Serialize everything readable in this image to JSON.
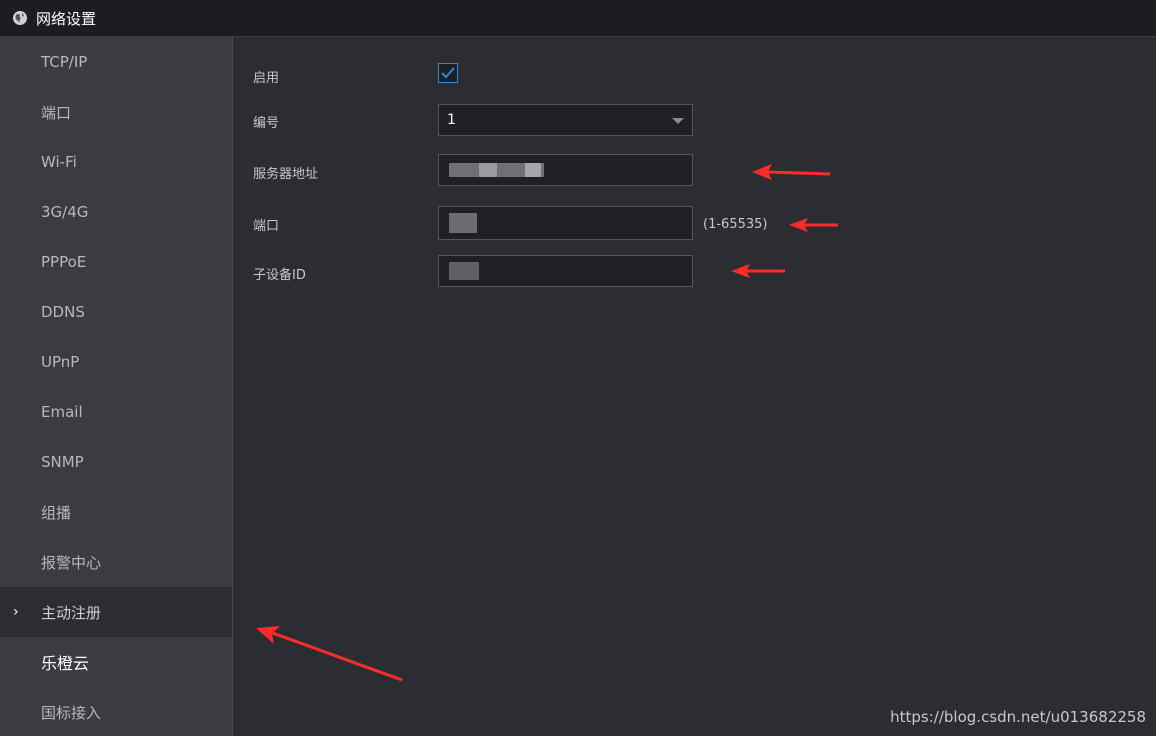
{
  "window": {
    "title": "网络设置",
    "icon": "globe-icon"
  },
  "sidebar": {
    "items": [
      {
        "label": "TCP/IP"
      },
      {
        "label": "端口"
      },
      {
        "label": "Wi-Fi"
      },
      {
        "label": "3G/4G"
      },
      {
        "label": "PPPoE"
      },
      {
        "label": "DDNS"
      },
      {
        "label": "UPnP"
      },
      {
        "label": "Email"
      },
      {
        "label": "SNMP"
      },
      {
        "label": "组播"
      },
      {
        "label": "报警中心"
      },
      {
        "label": "主动注册",
        "active": true,
        "marker": "›"
      },
      {
        "label": "乐橙云"
      },
      {
        "label": "国标接入"
      }
    ]
  },
  "form": {
    "enable": {
      "label": "启用",
      "checked": true
    },
    "number": {
      "label": "编号",
      "value": "1"
    },
    "server": {
      "label": "服务器地址"
    },
    "port": {
      "label": "端口",
      "hint": "(1-65535)"
    },
    "subdevice": {
      "label": "子设备ID"
    }
  },
  "watermark": "https://blog.csdn.net/u013682258",
  "colors": {
    "accent": "#2f8ad8",
    "annotation_arrow": "#ff2a2a"
  }
}
